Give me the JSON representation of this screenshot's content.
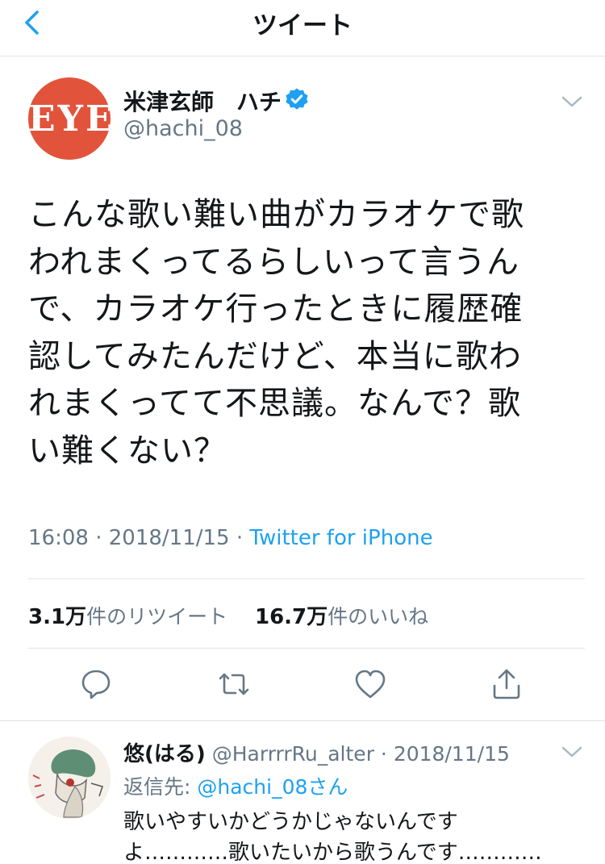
{
  "nav": {
    "title": "ツイート",
    "back_icon": "chevron-left-icon"
  },
  "tweet": {
    "avatar_text": "EYE",
    "author_name": "米津玄師　ハチ",
    "handle": "@hachi_08",
    "verified": true,
    "text_lines": [
      "こんな歌い難い曲がカラオケで歌",
      "われまくってるらしいって言うん",
      "で、カラオケ行ったときに履歴確",
      "認してみたんだけど、本当に歌わ",
      "れまくってて不思議。なんで？歌",
      "い難くない？"
    ],
    "time": "16:08",
    "date": "2018/11/15",
    "source": "Twitter for iPhone",
    "retweet_count": "3.1万",
    "retweet_label": "件のリツイート",
    "like_count": "16.7万",
    "like_label": "件のいいね"
  },
  "actions": [
    "reply-icon",
    "retweet-icon",
    "like-icon",
    "share-icon"
  ],
  "reply": {
    "name": "悠(はる)",
    "handle": "@HarrrrRu_alter",
    "date": "2018/11/15",
    "reply_to_label": "返信先:",
    "reply_to_handle": "@hachi_08さん",
    "text_lines": [
      "歌いやすいかどうかじゃないんです",
      "よ…………歌いたいから歌うんです…………"
    ]
  },
  "colors": {
    "link": "#1da1f2",
    "secondary": "#657786",
    "avatar": "#e2533b",
    "divider": "#dfe3e7"
  }
}
